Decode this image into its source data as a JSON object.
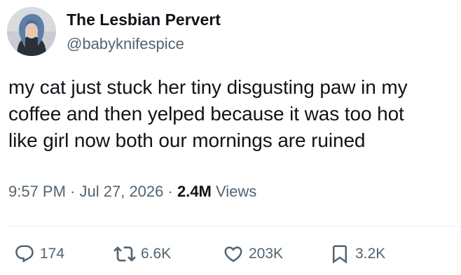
{
  "author": {
    "display_name": "The Lesbian Pervert",
    "handle": "@babyknifespice"
  },
  "tweet": {
    "lines": [
      "my cat just stuck her tiny disgusting paw in my",
      "coffee and then yelped because it was too hot",
      "like girl now both our mornings are ruined"
    ],
    "time": "9:57 PM",
    "separator": "·",
    "date": "Jul 27, 2026",
    "views_count": "2.4M",
    "views_label": "Views"
  },
  "actions": {
    "reply": {
      "icon": "reply-icon",
      "count": "174"
    },
    "retweet": {
      "icon": "retweet-icon",
      "count": "6.6K"
    },
    "like": {
      "icon": "heart-icon",
      "count": "203K"
    },
    "bookmark": {
      "icon": "bookmark-icon",
      "count": "3.2K"
    }
  },
  "colors": {
    "text_primary": "#0f1419",
    "text_secondary": "#536471",
    "divider": "#eff3f4",
    "background": "#ffffff"
  }
}
